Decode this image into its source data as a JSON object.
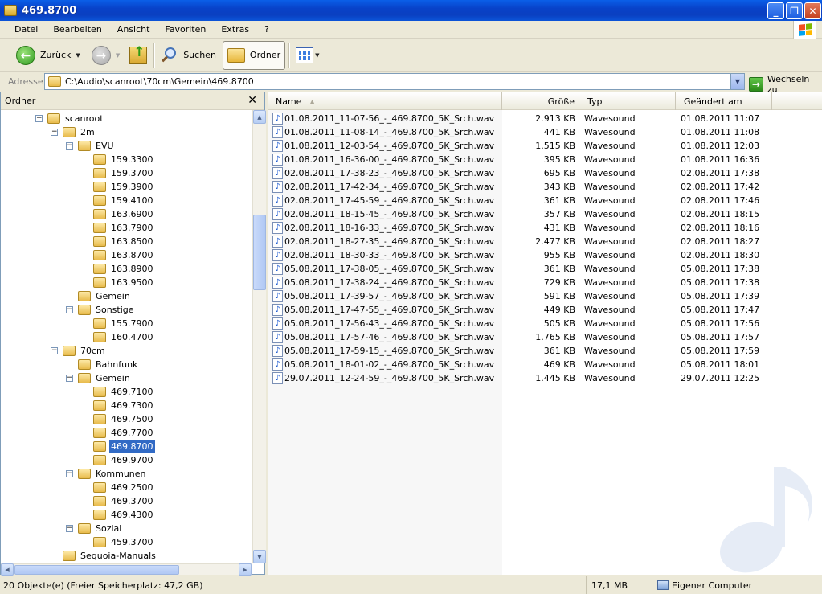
{
  "window": {
    "title": "469.8700"
  },
  "menu": [
    "Datei",
    "Bearbeiten",
    "Ansicht",
    "Favoriten",
    "Extras",
    "?"
  ],
  "toolbar": {
    "back_label": "Zurück",
    "search_label": "Suchen",
    "folders_label": "Ordner"
  },
  "address": {
    "label": "Adresse",
    "value": "C:\\Audio\\scanroot\\70cm\\Gemein\\469.8700",
    "go_label": "Wechseln zu"
  },
  "folder_pane": {
    "title": "Ordner",
    "close_glyph": "✕",
    "tree": [
      {
        "label": "scanroot",
        "expander": "−"
      },
      {
        "label": "2m",
        "expander": "−"
      },
      {
        "label": "EVU",
        "expander": "−"
      },
      {
        "label": "159.3300"
      },
      {
        "label": "159.3700"
      },
      {
        "label": "159.3900"
      },
      {
        "label": "159.4100"
      },
      {
        "label": "163.6900"
      },
      {
        "label": "163.7900"
      },
      {
        "label": "163.8500"
      },
      {
        "label": "163.8700"
      },
      {
        "label": "163.8900"
      },
      {
        "label": "163.9500"
      },
      {
        "label": "Gemein"
      },
      {
        "label": "Sonstige",
        "expander": "−"
      },
      {
        "label": "155.7900"
      },
      {
        "label": "160.4700"
      },
      {
        "label": "70cm",
        "expander": "−"
      },
      {
        "label": "Bahnfunk"
      },
      {
        "label": "Gemein",
        "expander": "−"
      },
      {
        "label": "469.7100"
      },
      {
        "label": "469.7300"
      },
      {
        "label": "469.7500"
      },
      {
        "label": "469.7700"
      },
      {
        "label": "469.8700",
        "selected": true
      },
      {
        "label": "469.9700"
      },
      {
        "label": "Kommunen",
        "expander": "−"
      },
      {
        "label": "469.2500"
      },
      {
        "label": "469.3700"
      },
      {
        "label": "469.4300"
      },
      {
        "label": "Sozial",
        "expander": "−"
      },
      {
        "label": "459.3700"
      },
      {
        "label": "Sequoia-Manuals"
      }
    ]
  },
  "file_list": {
    "columns": {
      "name": "Name",
      "size": "Größe",
      "type": "Typ",
      "date": "Geändert am"
    },
    "files": [
      {
        "name": "01.08.2011_11-07-56_-_469.8700_5K_Srch.wav",
        "size": "2.913 KB",
        "type": "Wavesound",
        "date": "01.08.2011 11:07"
      },
      {
        "name": "01.08.2011_11-08-14_-_469.8700_5K_Srch.wav",
        "size": "441 KB",
        "type": "Wavesound",
        "date": "01.08.2011 11:08"
      },
      {
        "name": "01.08.2011_12-03-54_-_469.8700_5K_Srch.wav",
        "size": "1.515 KB",
        "type": "Wavesound",
        "date": "01.08.2011 12:03"
      },
      {
        "name": "01.08.2011_16-36-00_-_469.8700_5K_Srch.wav",
        "size": "395 KB",
        "type": "Wavesound",
        "date": "01.08.2011 16:36"
      },
      {
        "name": "02.08.2011_17-38-23_-_469.8700_5K_Srch.wav",
        "size": "695 KB",
        "type": "Wavesound",
        "date": "02.08.2011 17:38"
      },
      {
        "name": "02.08.2011_17-42-34_-_469.8700_5K_Srch.wav",
        "size": "343 KB",
        "type": "Wavesound",
        "date": "02.08.2011 17:42"
      },
      {
        "name": "02.08.2011_17-45-59_-_469.8700_5K_Srch.wav",
        "size": "361 KB",
        "type": "Wavesound",
        "date": "02.08.2011 17:46"
      },
      {
        "name": "02.08.2011_18-15-45_-_469.8700_5K_Srch.wav",
        "size": "357 KB",
        "type": "Wavesound",
        "date": "02.08.2011 18:15"
      },
      {
        "name": "02.08.2011_18-16-33_-_469.8700_5K_Srch.wav",
        "size": "431 KB",
        "type": "Wavesound",
        "date": "02.08.2011 18:16"
      },
      {
        "name": "02.08.2011_18-27-35_-_469.8700_5K_Srch.wav",
        "size": "2.477 KB",
        "type": "Wavesound",
        "date": "02.08.2011 18:27"
      },
      {
        "name": "02.08.2011_18-30-33_-_469.8700_5K_Srch.wav",
        "size": "955 KB",
        "type": "Wavesound",
        "date": "02.08.2011 18:30"
      },
      {
        "name": "05.08.2011_17-38-05_-_469.8700_5K_Srch.wav",
        "size": "361 KB",
        "type": "Wavesound",
        "date": "05.08.2011 17:38"
      },
      {
        "name": "05.08.2011_17-38-24_-_469.8700_5K_Srch.wav",
        "size": "729 KB",
        "type": "Wavesound",
        "date": "05.08.2011 17:38"
      },
      {
        "name": "05.08.2011_17-39-57_-_469.8700_5K_Srch.wav",
        "size": "591 KB",
        "type": "Wavesound",
        "date": "05.08.2011 17:39"
      },
      {
        "name": "05.08.2011_17-47-55_-_469.8700_5K_Srch.wav",
        "size": "449 KB",
        "type": "Wavesound",
        "date": "05.08.2011 17:47"
      },
      {
        "name": "05.08.2011_17-56-43_-_469.8700_5K_Srch.wav",
        "size": "505 KB",
        "type": "Wavesound",
        "date": "05.08.2011 17:56"
      },
      {
        "name": "05.08.2011_17-57-46_-_469.8700_5K_Srch.wav",
        "size": "1.765 KB",
        "type": "Wavesound",
        "date": "05.08.2011 17:57"
      },
      {
        "name": "05.08.2011_17-59-15_-_469.8700_5K_Srch.wav",
        "size": "361 KB",
        "type": "Wavesound",
        "date": "05.08.2011 17:59"
      },
      {
        "name": "05.08.2011_18-01-02_-_469.8700_5K_Srch.wav",
        "size": "469 KB",
        "type": "Wavesound",
        "date": "05.08.2011 18:01"
      },
      {
        "name": "29.07.2011_12-24-59_-_469.8700_5K_Srch.wav",
        "size": "1.445 KB",
        "type": "Wavesound",
        "date": "29.07.2011 12:25"
      }
    ]
  },
  "statusbar": {
    "objects": "20 Objekte(e) (Freier Speicherplatz: 47,2 GB)",
    "size": "17,1 MB",
    "location": "Eigener Computer"
  },
  "icons": {
    "file": "wavesound-file-icon",
    "folder": "folder-icon",
    "watermark": "music-note-icon"
  },
  "colors": {
    "titlebar": "#0a3fc0",
    "selection": "#316ac5",
    "chrome": "#ece9d8"
  }
}
